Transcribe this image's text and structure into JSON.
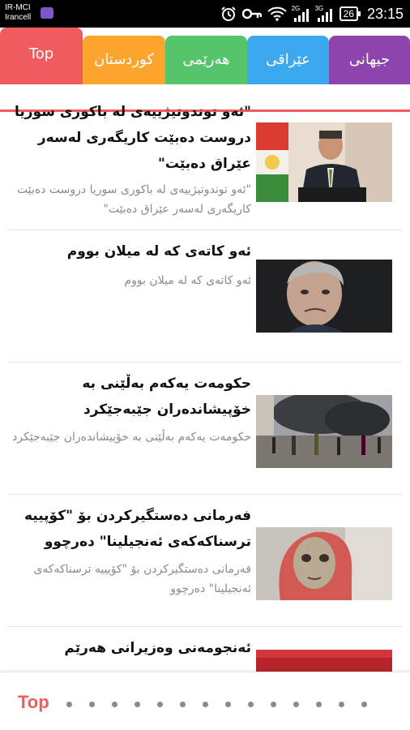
{
  "status_bar": {
    "carrier_1": "IR-MCI",
    "carrier_2": "Irancell",
    "network_1": "2G",
    "network_2": "3G",
    "battery": "26",
    "time": "23:15"
  },
  "tabs": [
    {
      "label": "Top",
      "color": "#ef5b5f",
      "active": true
    },
    {
      "label": "کوردستان",
      "color": "#fba52f"
    },
    {
      "label": "هەرێمی",
      "color": "#56c46b"
    },
    {
      "label": "عێراقی",
      "color": "#3aa9f0"
    },
    {
      "label": "جیهانی",
      "color": "#8e44ad"
    }
  ],
  "articles": [
    {
      "title": "\"ئەو توندوتیژییەی لە باکوری سوریا دروست دەبێت کاریگەری لەسەر عێراق دەبێت\"",
      "summary": "\"ئەو توندوتیژییەی لە باکوری سوریا دروست دەبێت کاریگەری لەسەر عێراق دەبێت\"",
      "image": "politician-podium-photo"
    },
    {
      "title": "ئەو کاتەی کە لە میلان بووم",
      "summary": "ئەو کاتەی کە لە میلان بووم",
      "image": "coach-portrait-photo"
    },
    {
      "title": "حکومەت یەکەم بەڵێنی بە خۆپیشاندەران جێبەجێکرد",
      "summary": "حکومەت یەکەم بەڵێنی بە خۆپیشاندەران جێبەجێکرد",
      "image": "protest-street-photo"
    },
    {
      "title": "فەرمانی دەستگیرکردن بۆ \"کۆپییە ترسناکەکەی ئەنجیلینا\" دەرچوو",
      "summary": "فەرمانی دەستگیرکردن بۆ \"کۆپییە ترسناکەکەی ئەنجیلینا\" دەرچوو",
      "image": "woman-portrait-photo"
    },
    {
      "title": "ئەنجومەنی وەزیرانی هەرێم",
      "image": "red-banner-photo"
    }
  ],
  "bottom_bar": {
    "label": "Top",
    "color": "#ef5b5f",
    "page_dots": 14
  }
}
